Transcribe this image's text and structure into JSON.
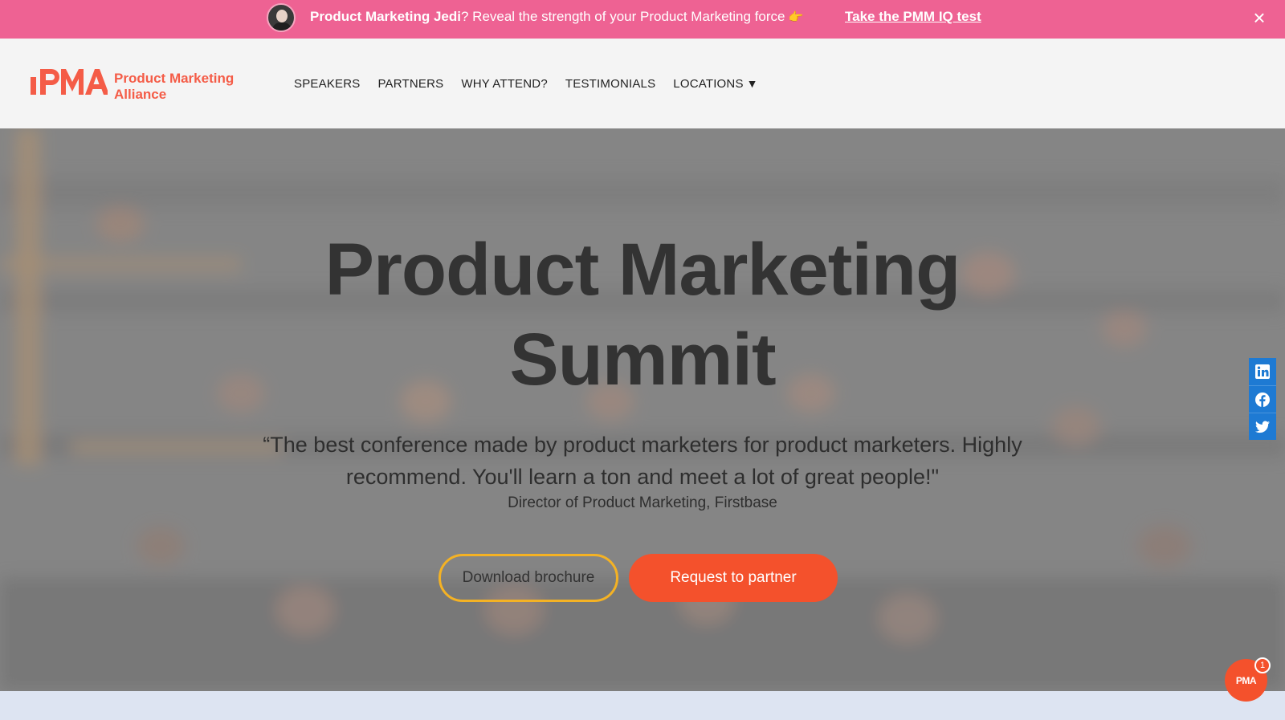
{
  "announcement": {
    "bold_text": "Product Marketing Jedi",
    "text": "? Reveal the strength of your Product Marketing force",
    "emoji": "👉",
    "cta": "Take the PMM IQ test",
    "close_icon": "×"
  },
  "header": {
    "logo_mark": "PMA",
    "logo_name_line1": "Product Marketing",
    "logo_name_line2": "Alliance",
    "nav": {
      "speakers": "SPEAKERS",
      "partners": "PARTNERS",
      "why_attend": "WHY ATTEND?",
      "testimonials": "TESTIMONIALS",
      "locations": "LOCATIONS",
      "locations_caret": "▼"
    }
  },
  "hero": {
    "title_line1": "Product Marketing",
    "title_line2": "Summit",
    "quote_line1": "“The best conference made by product marketers for product marketers. Highly",
    "quote_line2": "recommend. You'll learn a ton and meet a lot of great people!\"",
    "attribution": "Director of Product Marketing, Firstbase",
    "btn_brochure": "Download brochure",
    "btn_partner": "Request to partner"
  },
  "share": {
    "icons": [
      "linkedin-icon",
      "facebook-icon",
      "twitter-icon"
    ]
  },
  "chat": {
    "label": "PMA",
    "badge_count": "1"
  },
  "colors": {
    "announcement_bg": "#ee6293",
    "brand_orange": "#f45c47",
    "button_orange": "#f4512c",
    "button_outline": "#f4b224",
    "share_blue": "#1e7ad3"
  }
}
